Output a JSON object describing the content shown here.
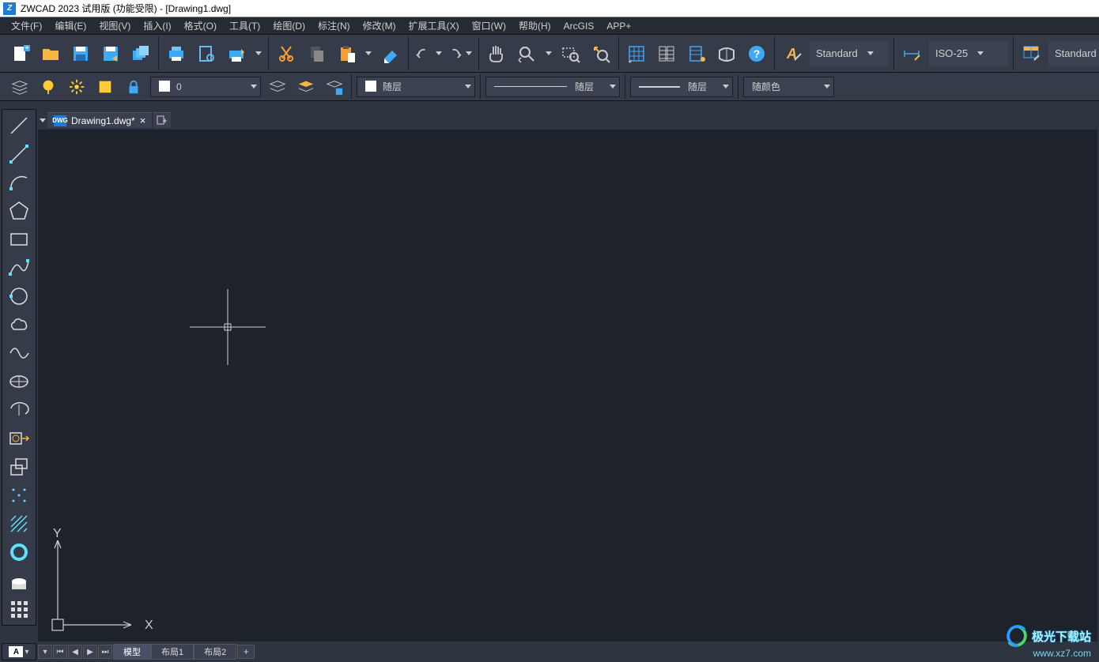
{
  "title": "ZWCAD 2023 试用版 (功能受限) - [Drawing1.dwg]",
  "menu": [
    "文件(F)",
    "编辑(E)",
    "视图(V)",
    "插入(I)",
    "格式(O)",
    "工具(T)",
    "绘图(D)",
    "标注(N)",
    "修改(M)",
    "扩展工具(X)",
    "窗口(W)",
    "帮助(H)",
    "ArcGIS",
    "APP+"
  ],
  "toolbar_main": {
    "style_combo": "Standard",
    "dim_combo": "ISO-25",
    "style_label": "Standard"
  },
  "properties": {
    "layer": "0",
    "linetype": "随层",
    "lineweight": "随层",
    "lineweight2": "随层",
    "color": "随颜色"
  },
  "document": {
    "tab_label": "Drawing1.dwg*",
    "dwg_badge": "DWG"
  },
  "layout_tabs": [
    "模型",
    "布局1",
    "布局2"
  ],
  "cmd_badge": "A",
  "axis": {
    "x": "X",
    "y": "Y"
  },
  "watermark": {
    "title": "极光下载站",
    "url": "www.xz7.com"
  },
  "colors": {
    "bg": "#2e3440",
    "panel": "#353b48",
    "canvas": "#1d222b",
    "accent_blue": "#1e7bd8",
    "icon_yellow": "#ffcc33",
    "icon_orange": "#ff9b33",
    "icon_cyan": "#5fe0ff"
  }
}
